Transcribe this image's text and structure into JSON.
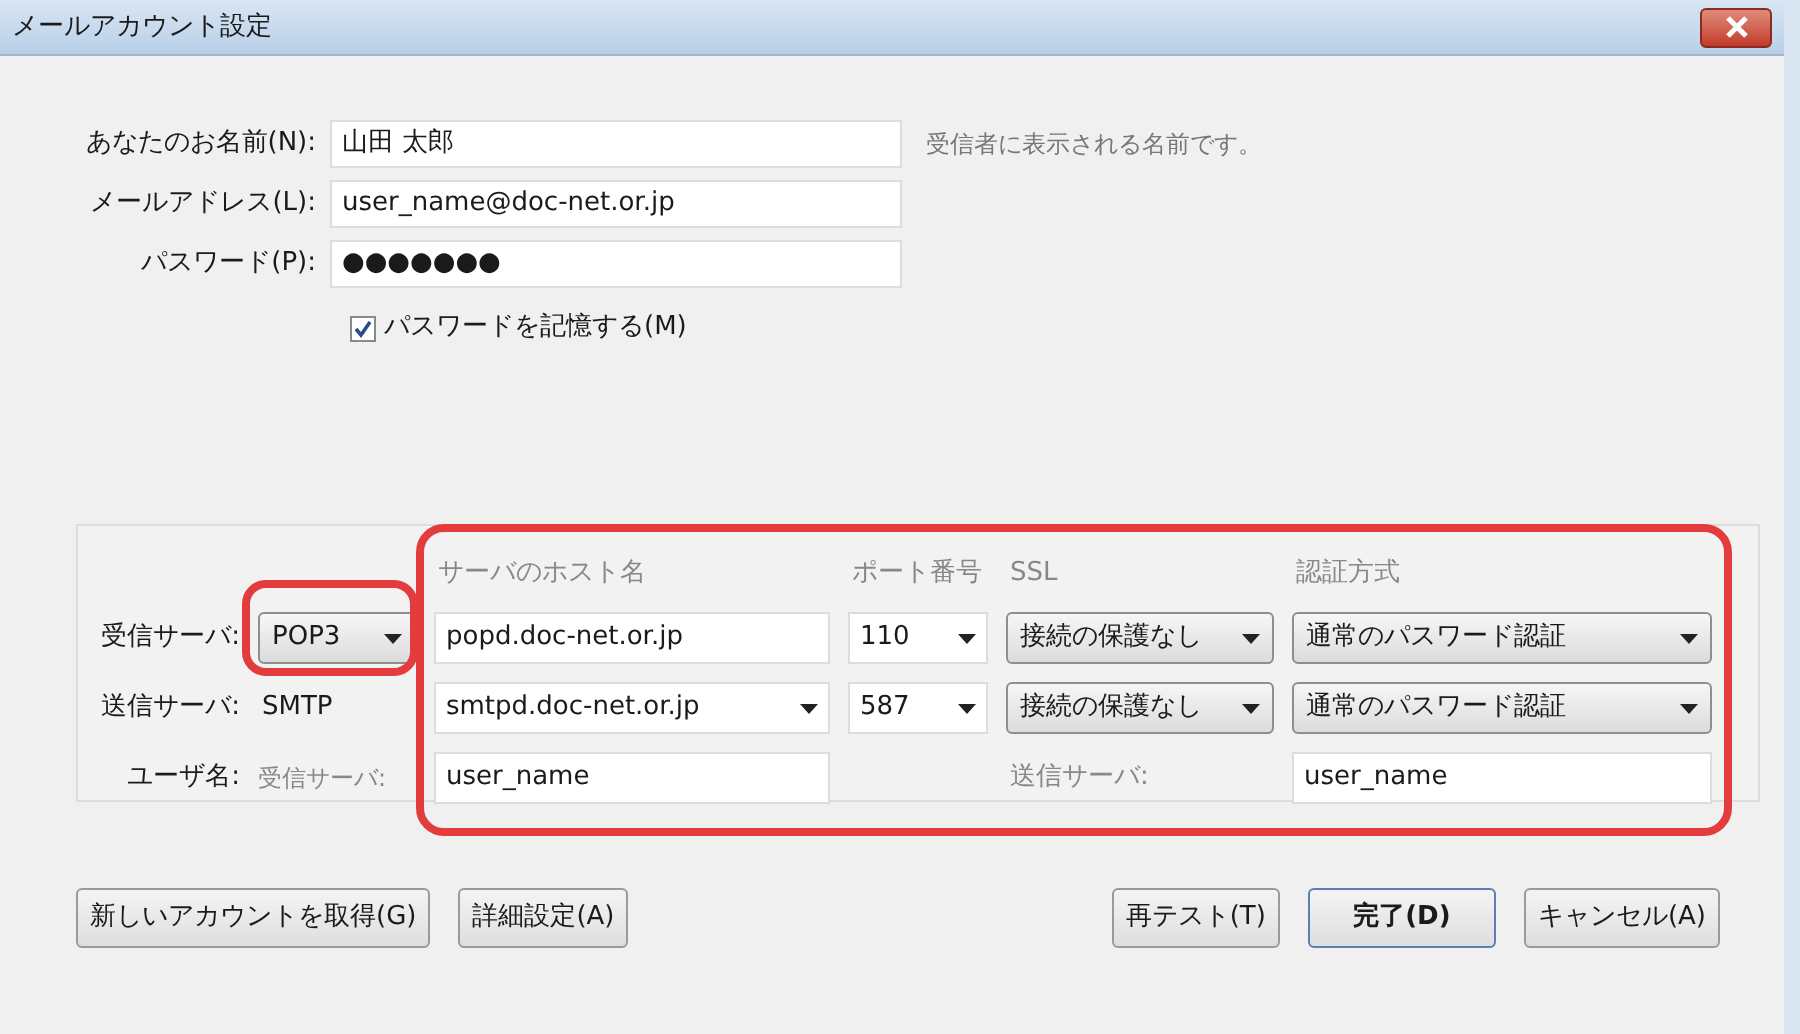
{
  "window": {
    "title": "メールアカウント設定"
  },
  "fields": [
    {
      "label": "あなたのお名前(N):",
      "value": "山田 太郎",
      "hint": "受信者に表示される名前です。"
    },
    {
      "label": "メールアドレス(L):",
      "value": "user_name@doc-net.or.jp"
    },
    {
      "label": "パスワード(P):",
      "value": "●●●●●●●"
    }
  ],
  "remember_password": {
    "label": "パスワードを記憶する(M)",
    "checked": true
  },
  "server_table": {
    "headers": [
      "サーバのホスト名",
      "ポート番号",
      "SSL",
      "認証方式"
    ],
    "incoming": {
      "label": "受信サーバ:",
      "type": "POP3",
      "host": "popd.doc-net.or.jp",
      "port": "110",
      "ssl": "接続の保護なし",
      "auth": "通常のパスワード認証"
    },
    "outgoing": {
      "label": "送信サーバ:",
      "type": "SMTP",
      "host": "smtpd.doc-net.or.jp",
      "port": "587",
      "ssl": "接続の保護なし",
      "auth": "通常のパスワード認証"
    },
    "username": {
      "label": "ユーザ名:",
      "incoming_label": "受信サーバ:",
      "incoming_value": "user_name",
      "outgoing_label": "送信サーバ:",
      "outgoing_value": "user_name"
    }
  },
  "buttons_left": [
    {
      "label": "新しいアカウントを取得(G)",
      "default": false
    },
    {
      "label": "詳細設定(A)",
      "default": false
    }
  ],
  "buttons_right": [
    {
      "label": "再テスト(T)",
      "default": false
    },
    {
      "label": "完了(D)",
      "default": true
    },
    {
      "label": "キャンセル(A)",
      "default": false
    }
  ]
}
